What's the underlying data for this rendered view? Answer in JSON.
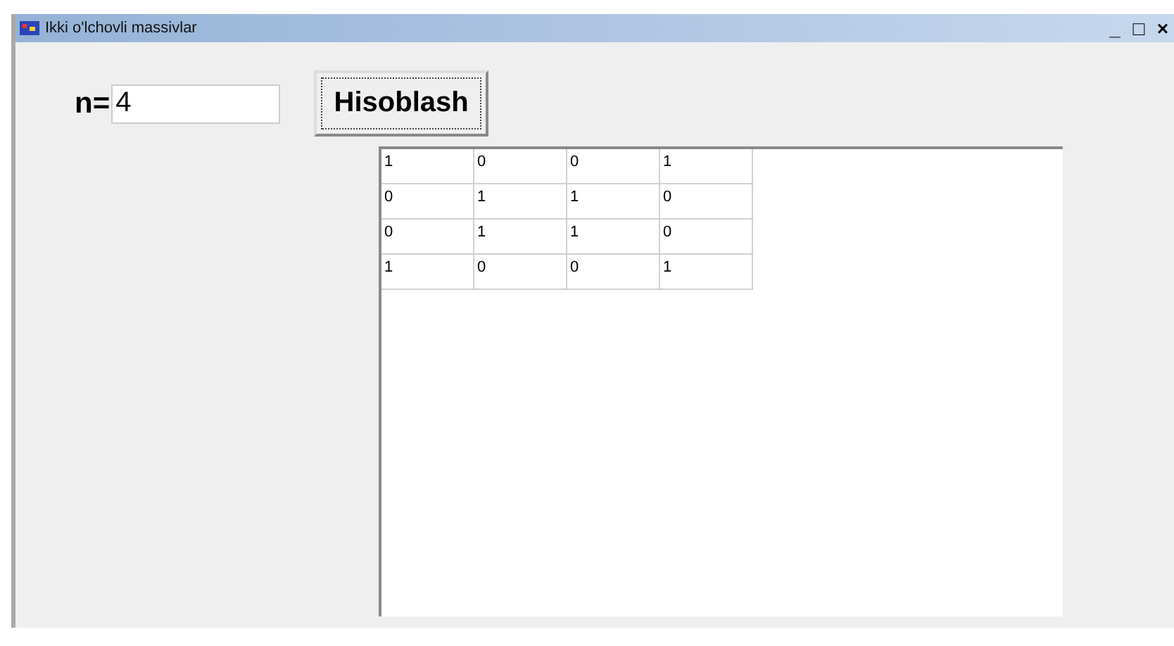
{
  "window": {
    "title": "Ikki o'lchovli massivlar",
    "controls": [
      "_",
      "□",
      "×"
    ]
  },
  "input": {
    "label": "n=",
    "value": "4"
  },
  "button": {
    "label": "Hisoblash"
  },
  "grid": {
    "rows": [
      [
        "1",
        "0",
        "0",
        "1"
      ],
      [
        "0",
        "1",
        "1",
        "0"
      ],
      [
        "0",
        "1",
        "1",
        "0"
      ],
      [
        "1",
        "0",
        "0",
        "1"
      ]
    ]
  }
}
